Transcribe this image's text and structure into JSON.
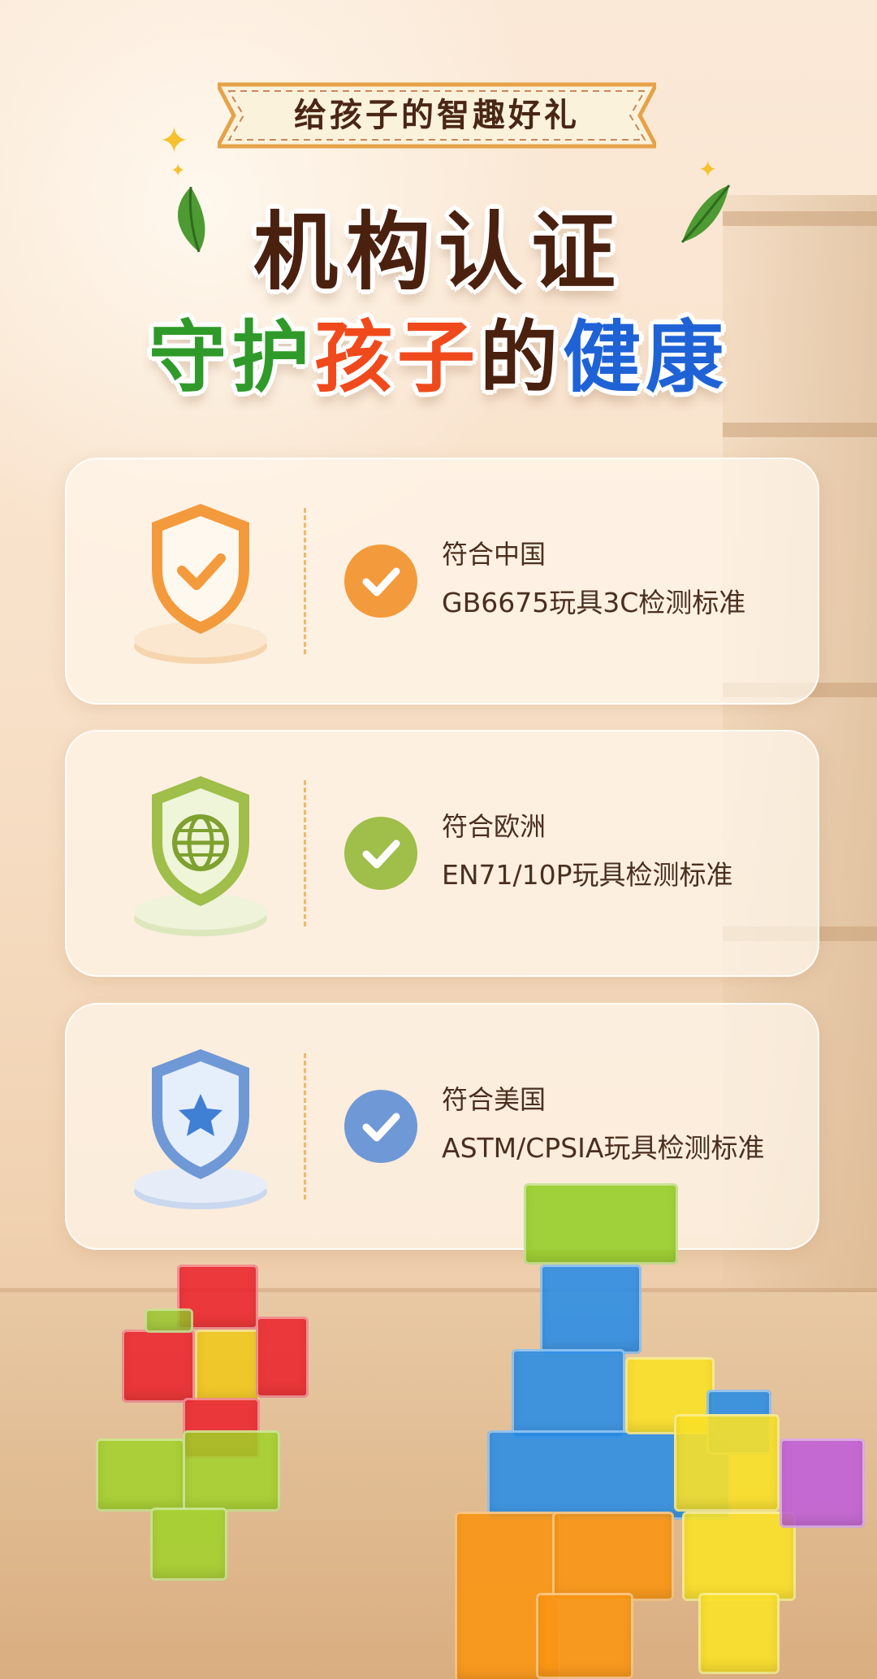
{
  "banner": {
    "text": "给孩子的智趣好礼"
  },
  "headline": {
    "line1": "机构认证",
    "line2": [
      {
        "text": "守护",
        "color": "#2f9a2a"
      },
      {
        "text": "孩子",
        "color": "#f04a1c"
      },
      {
        "text": "的",
        "color": "#4a200f"
      },
      {
        "text": "健康",
        "color": "#1f62d6"
      }
    ]
  },
  "certifications": [
    {
      "icon": "checkmark-shield-icon",
      "accent": "#f39a3c",
      "line1": "符合中国",
      "line2": "GB6675玩具3C检测标准"
    },
    {
      "icon": "globe-shield-icon",
      "accent": "#9fbe4a",
      "line1": "符合欧洲",
      "line2": "EN71/10P玩具检测标准"
    },
    {
      "icon": "star-shield-icon",
      "accent": "#6f98d6",
      "line1": "符合美国",
      "line2": "ASTM/CPSIA玩具检测标准"
    }
  ]
}
